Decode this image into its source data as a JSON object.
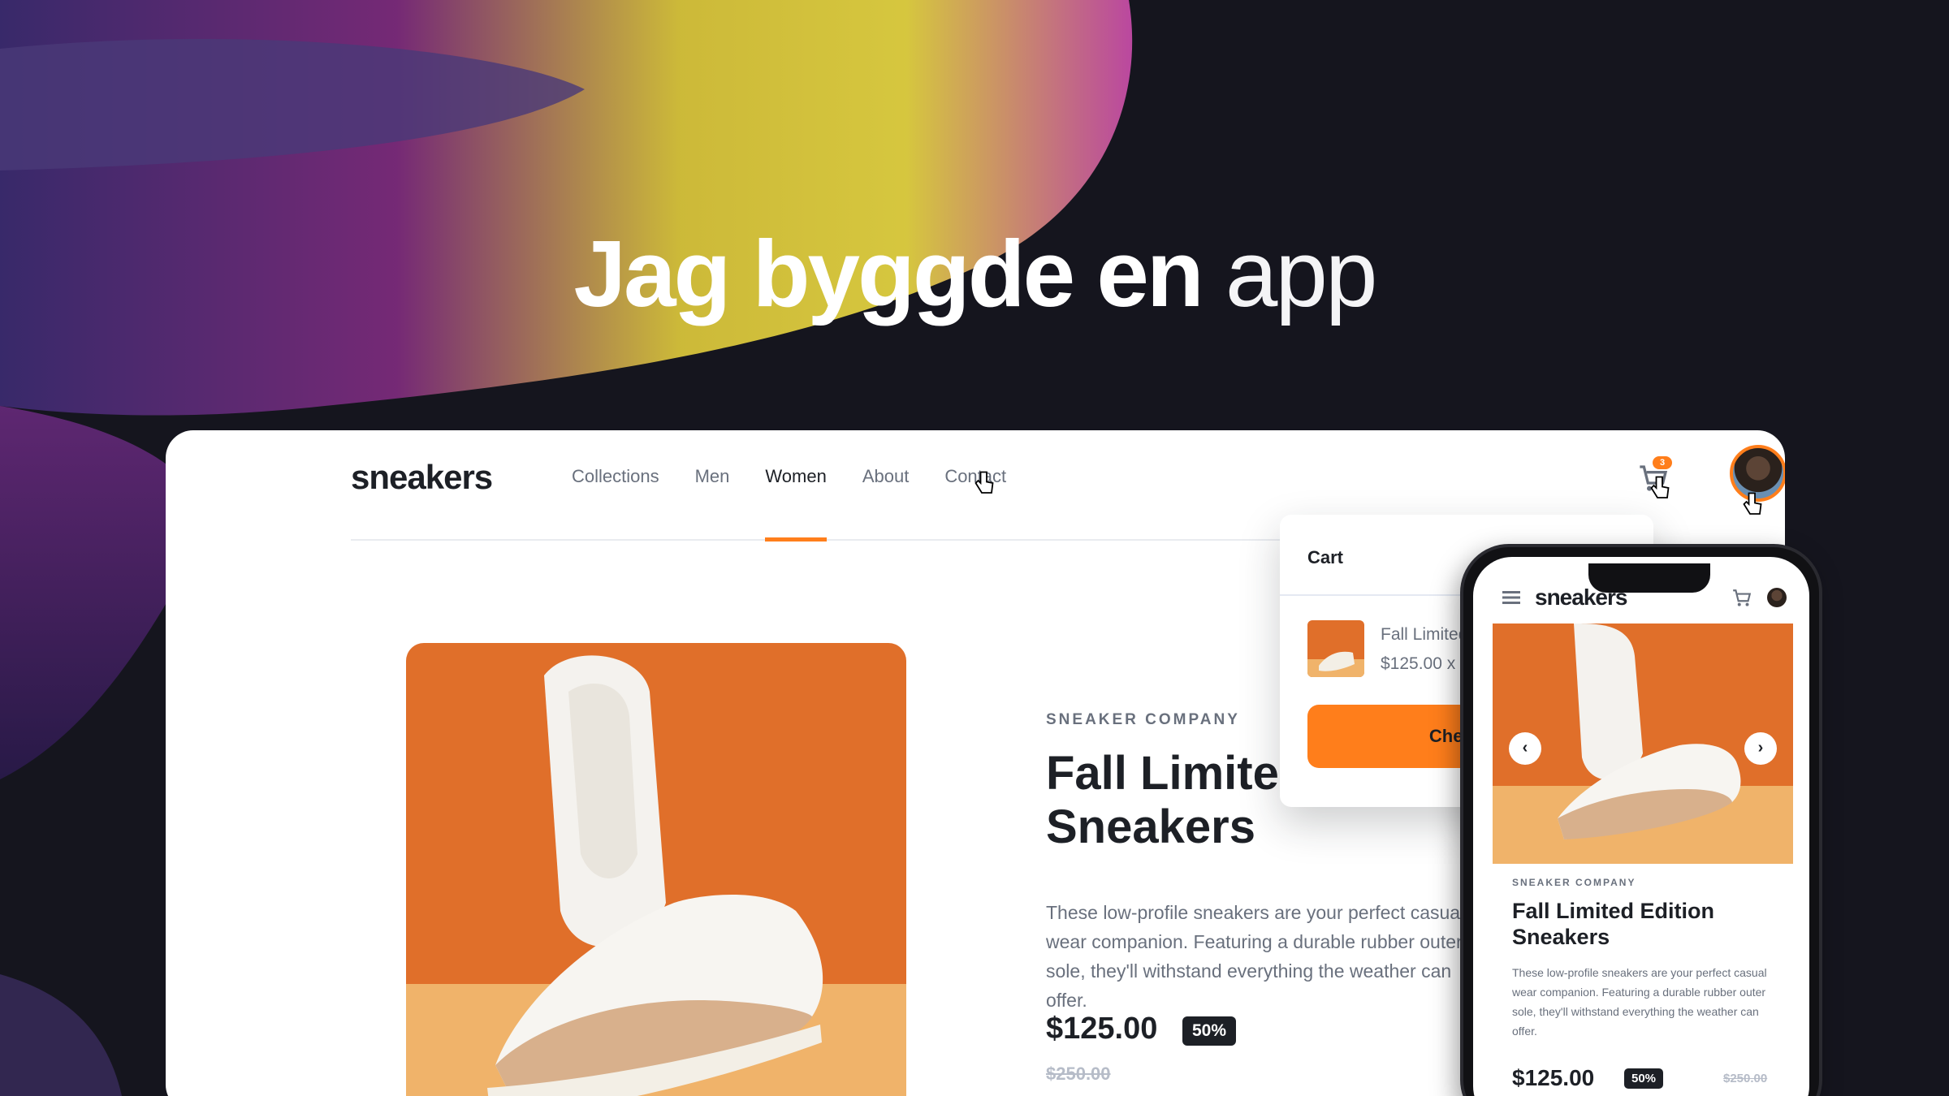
{
  "headline": {
    "strong": "Jag byggde en",
    "light": "app"
  },
  "desktop": {
    "logo": "sneakers",
    "nav": [
      "Collections",
      "Men",
      "Women",
      "About",
      "Contact"
    ],
    "active_nav": "Women",
    "cart_count": "3",
    "product": {
      "brand": "SNEAKER COMPANY",
      "title_line1": "Fall Limited Edition",
      "title_line2": "Sneakers",
      "description": "These low-profile sneakers are your perfect casual wear companion. Featuring a durable rubber outer sole, they'll withstand everything the weather can offer.",
      "price": "$125.00",
      "discount": "50%",
      "old_price": "$250.00"
    },
    "cart_popup": {
      "title": "Cart",
      "item_name": "Fall Limited Edition Sneakers",
      "item_line": "$125.00 x 3",
      "checkout": "Checkout"
    }
  },
  "mobile": {
    "logo": "sneakers",
    "brand": "SNEAKER COMPANY",
    "title": "Fall Limited Edition Sneakers",
    "description": "These low-profile sneakers are your perfect casual wear companion. Featuring a durable rubber outer sole, they'll withstand everything the weather can offer.",
    "price": "$125.00",
    "discount": "50%",
    "old_price": "$250.00",
    "prev": "‹",
    "next": "›"
  },
  "colors": {
    "accent": "#ff7e1b",
    "dark": "#1d2026",
    "muted": "#69707d",
    "background": "#15151e"
  }
}
